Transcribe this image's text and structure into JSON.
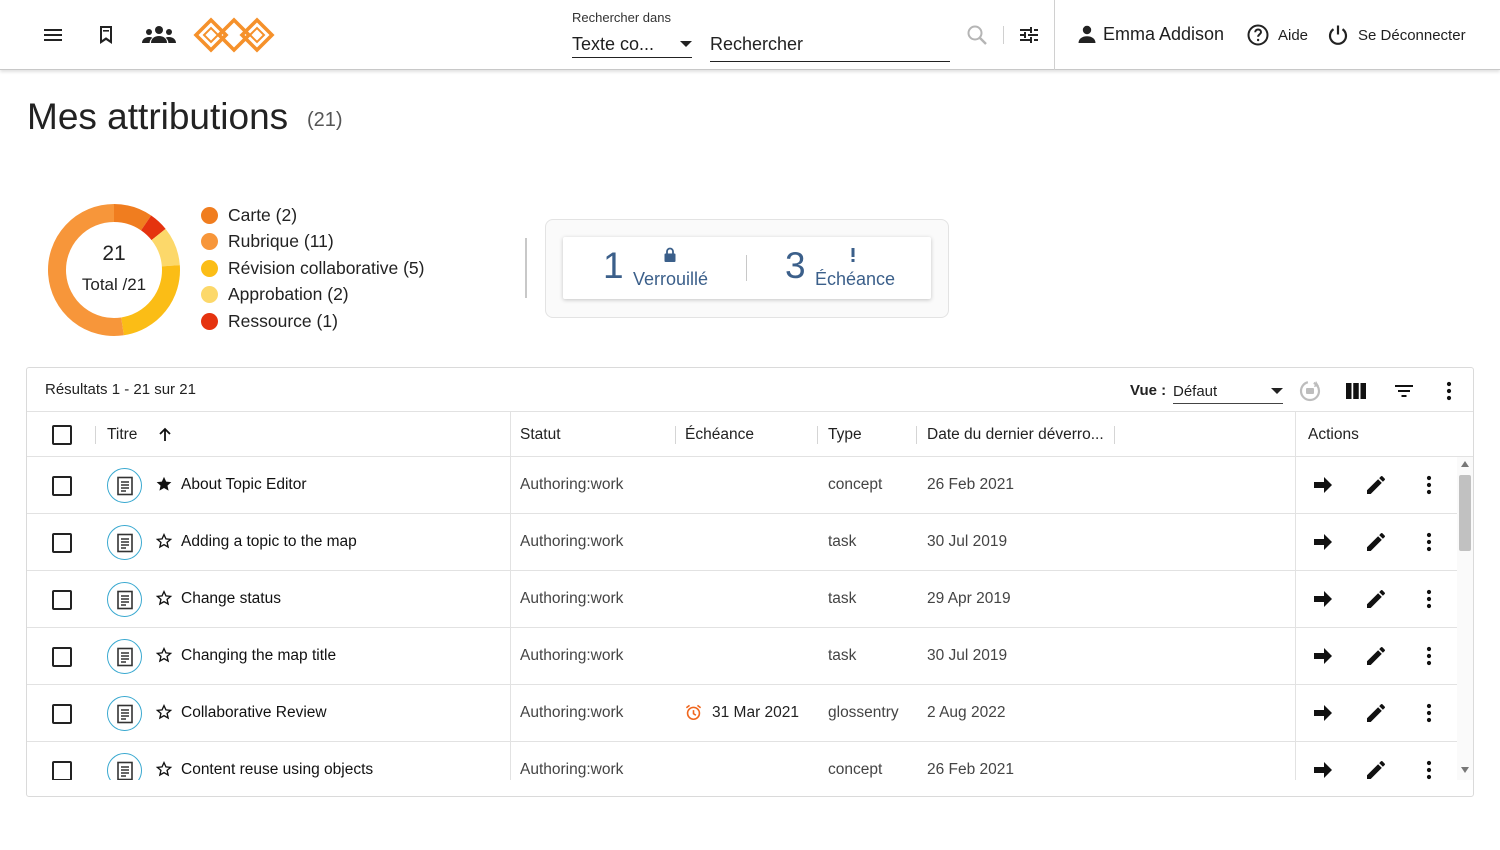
{
  "header": {
    "search_scope_label": "Rechercher dans",
    "search_scope_value": "Texte co...",
    "search_placeholder": "Rechercher",
    "user_name": "Emma Addison",
    "help_label": "Aide",
    "logout_label": "Se Déconnecter"
  },
  "page": {
    "title": "Mes attributions",
    "count": "(21)"
  },
  "summary": {
    "total_number": "21",
    "total_label": "Total /21",
    "legend": [
      {
        "label": "Carte (2)",
        "color": "#f07d1f"
      },
      {
        "label": "Rubrique (11)",
        "color": "#f7963a"
      },
      {
        "label": "Révision collaborative (5)",
        "color": "#fbbd16"
      },
      {
        "label": "Approbation (2)",
        "color": "#fcd86a"
      },
      {
        "label": "Ressource (1)",
        "color": "#e5330f"
      }
    ],
    "stats": [
      {
        "number": "1",
        "label": "Verrouillé"
      },
      {
        "number": "3",
        "label": "Échéance"
      }
    ]
  },
  "table": {
    "results_text": "Résultats 1 - 21 sur 21",
    "view_label": "Vue :",
    "view_value": "Défaut",
    "columns": {
      "title": "Titre",
      "status": "Statut",
      "due": "Échéance",
      "type": "Type",
      "last_unlock": "Date du dernier déverro...",
      "actions": "Actions"
    },
    "rows": [
      {
        "title": "About Topic Editor",
        "starred": true,
        "status": "Authoring:work",
        "due": "",
        "type": "concept",
        "date": "26 Feb 2021"
      },
      {
        "title": "Adding a topic to the map",
        "starred": false,
        "status": "Authoring:work",
        "due": "",
        "type": "task",
        "date": "30 Jul 2019"
      },
      {
        "title": "Change status",
        "starred": false,
        "status": "Authoring:work",
        "due": "",
        "type": "task",
        "date": "29 Apr 2019"
      },
      {
        "title": "Changing the map title",
        "starred": false,
        "status": "Authoring:work",
        "due": "",
        "type": "task",
        "date": "30 Jul 2019"
      },
      {
        "title": "Collaborative Review",
        "starred": false,
        "status": "Authoring:work",
        "due": "31 Mar 2021",
        "type": "glossentry",
        "date": "2 Aug 2022"
      },
      {
        "title": "Content reuse using objects",
        "starred": false,
        "status": "Authoring:work",
        "due": "",
        "type": "concept",
        "date": "26 Feb 2021"
      }
    ]
  }
}
